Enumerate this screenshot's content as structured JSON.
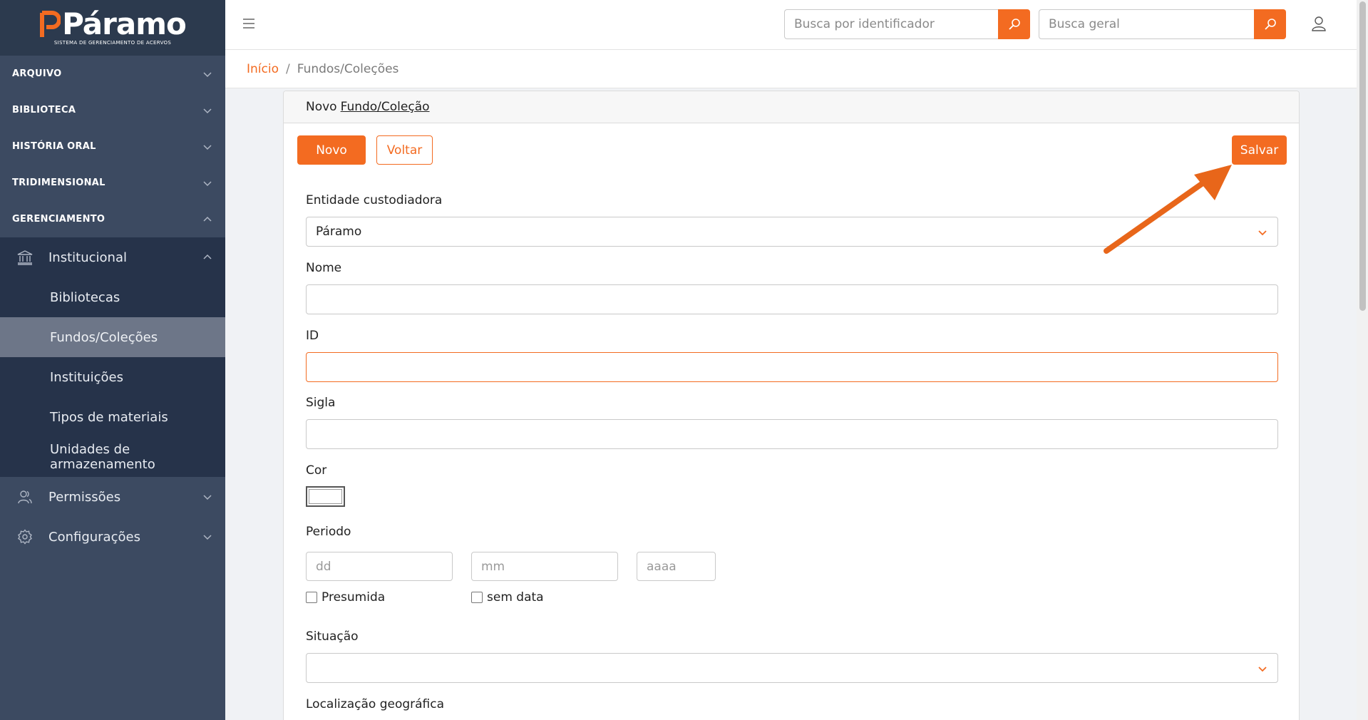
{
  "logo": {
    "name": "Páramo",
    "tagline": "SISTEMA DE GERENCIAMENTO DE ACERVOS"
  },
  "sidebar": {
    "sections": [
      {
        "label": "ARQUIVO"
      },
      {
        "label": "BIBLIOTECA"
      },
      {
        "label": "HISTÓRIA ORAL"
      },
      {
        "label": "TRIDIMENSIONAL"
      },
      {
        "label": "GERENCIAMENTO"
      }
    ],
    "institucional": {
      "label": "Institucional",
      "items": [
        "Bibliotecas",
        "Fundos/Coleções",
        "Instituições",
        "Tipos de materiais",
        "Unidades de armazenamento"
      ]
    },
    "permissoes": "Permissões",
    "configuracoes": "Configurações"
  },
  "header": {
    "search_id_placeholder": "Busca por identificador",
    "search_general_placeholder": "Busca geral"
  },
  "breadcrumb": {
    "home": "Início",
    "separator": "/",
    "current": "Fundos/Coleções"
  },
  "card": {
    "title_prefix": "Novo",
    "title_link": "Fundo/Coleção",
    "buttons": {
      "novo": "Novo",
      "voltar": "Voltar",
      "salvar": "Salvar"
    }
  },
  "form": {
    "entidade": {
      "label": "Entidade custodiadora",
      "value": "Páramo"
    },
    "nome": {
      "label": "Nome",
      "value": ""
    },
    "id": {
      "label": "ID",
      "value": ""
    },
    "sigla": {
      "label": "Sigla",
      "value": ""
    },
    "cor": {
      "label": "Cor"
    },
    "periodo": {
      "label": "Periodo",
      "dd": "dd",
      "mm": "mm",
      "aaaa": "aaaa",
      "presumida": "Presumida",
      "sem_data": "sem data"
    },
    "situacao": {
      "label": "Situação",
      "value": ""
    },
    "localizacao": {
      "label": "Localização geográfica"
    }
  },
  "colors": {
    "accent": "#f36b21",
    "sidebar": "#3c4a61",
    "sidebar_dark": "#26334a",
    "active_item": "#6d7688"
  }
}
